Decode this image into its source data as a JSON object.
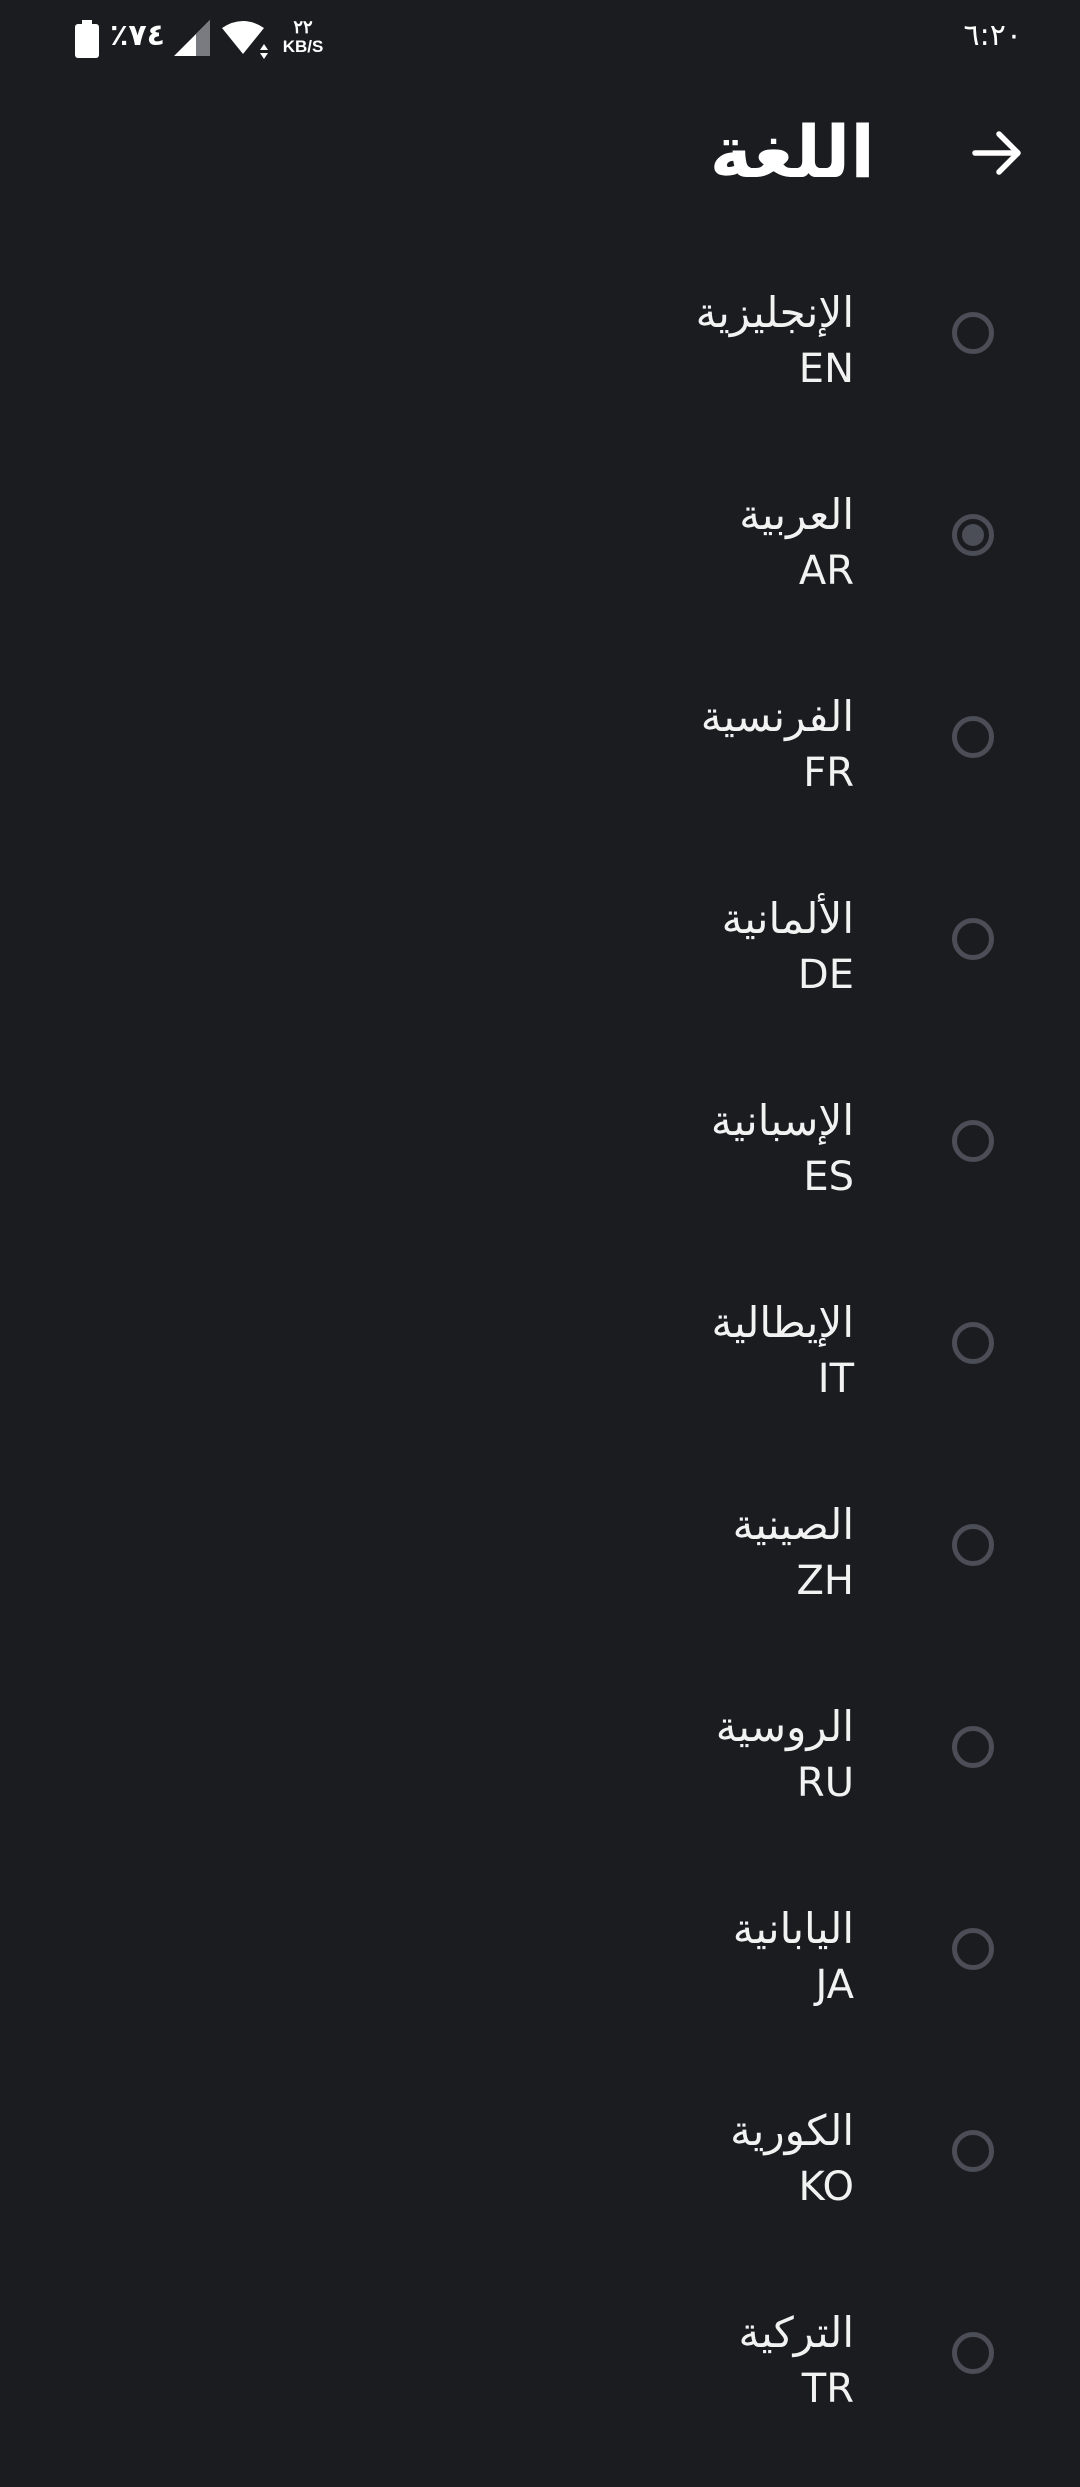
{
  "status_bar": {
    "time": "٦:٢٠",
    "battery": "٪٧٤",
    "speed_value": "٢٢",
    "speed_unit": "KB/S",
    "icons": [
      "battery-icon",
      "signal-icon",
      "wifi-icon"
    ]
  },
  "header": {
    "title": "اللغة",
    "back_icon": "arrow-right-icon"
  },
  "colors": {
    "background": "#1b1c20",
    "text": "#ffffff",
    "radio": "#4b4d57"
  },
  "languages": [
    {
      "name": "الإنجليزية",
      "code": "EN",
      "selected": false
    },
    {
      "name": "العربية",
      "code": "AR",
      "selected": true
    },
    {
      "name": "الفرنسية",
      "code": "FR",
      "selected": false
    },
    {
      "name": "الألمانية",
      "code": "DE",
      "selected": false
    },
    {
      "name": "الإسبانية",
      "code": "ES",
      "selected": false
    },
    {
      "name": "الإيطالية",
      "code": "IT",
      "selected": false
    },
    {
      "name": "الصينية",
      "code": "ZH",
      "selected": false
    },
    {
      "name": "الروسية",
      "code": "RU",
      "selected": false
    },
    {
      "name": "اليابانية",
      "code": "JA",
      "selected": false
    },
    {
      "name": "الكورية",
      "code": "KO",
      "selected": false
    },
    {
      "name": "التركية",
      "code": "TR",
      "selected": false
    }
  ]
}
